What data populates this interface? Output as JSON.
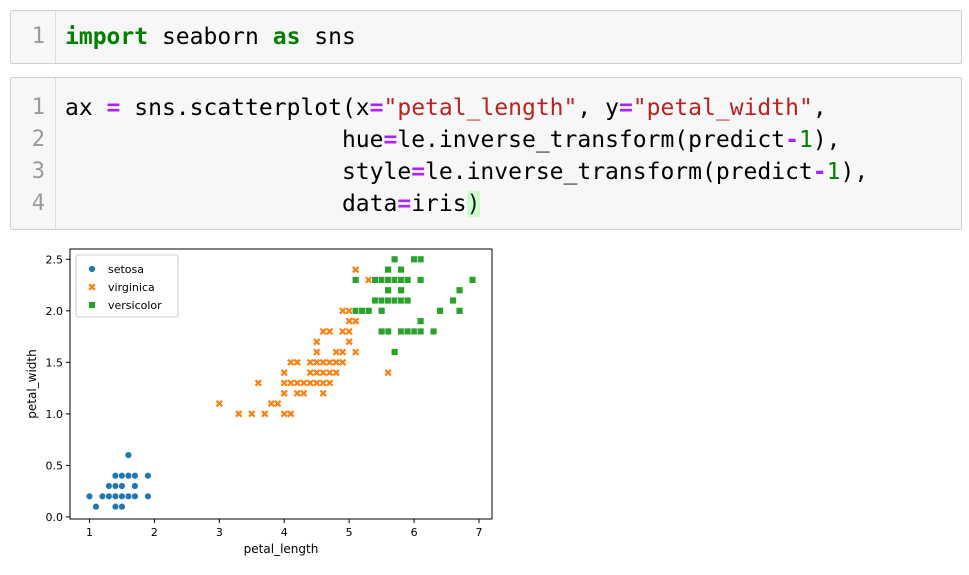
{
  "cell1": {
    "line_numbers": [
      "1"
    ],
    "code": "import seaborn as sns",
    "tokens": [
      {
        "t": "import",
        "c": "kw"
      },
      {
        "t": " seaborn ",
        "c": ""
      },
      {
        "t": "as",
        "c": "kw"
      },
      {
        "t": " sns",
        "c": ""
      }
    ]
  },
  "cell2": {
    "line_numbers": [
      "1",
      "2",
      "3",
      "4"
    ],
    "lines": [
      [
        {
          "t": "ax ",
          "c": ""
        },
        {
          "t": "=",
          "c": "op"
        },
        {
          "t": " sns.scatterplot(x",
          "c": ""
        },
        {
          "t": "=",
          "c": "op"
        },
        {
          "t": "\"petal_length\"",
          "c": "str"
        },
        {
          "t": ", y",
          "c": ""
        },
        {
          "t": "=",
          "c": "op"
        },
        {
          "t": "\"petal_width\"",
          "c": "str"
        },
        {
          "t": ",",
          "c": ""
        }
      ],
      [
        {
          "t": "                    hue",
          "c": ""
        },
        {
          "t": "=",
          "c": "op"
        },
        {
          "t": "le.inverse_transform(predict",
          "c": ""
        },
        {
          "t": "-",
          "c": "op"
        },
        {
          "t": "1",
          "c": "num"
        },
        {
          "t": "),",
          "c": ""
        }
      ],
      [
        {
          "t": "                    style",
          "c": ""
        },
        {
          "t": "=",
          "c": "op"
        },
        {
          "t": "le.inverse_transform(predict",
          "c": ""
        },
        {
          "t": "-",
          "c": "op"
        },
        {
          "t": "1",
          "c": "num"
        },
        {
          "t": "),",
          "c": ""
        }
      ],
      [
        {
          "t": "                    data",
          "c": ""
        },
        {
          "t": "=",
          "c": "op"
        },
        {
          "t": "iris",
          "c": ""
        },
        {
          "t": ")",
          "c": "cur"
        }
      ]
    ]
  },
  "chart_data": {
    "type": "scatter",
    "xlabel": "petal_length",
    "ylabel": "petal_width",
    "xlim": [
      0.7,
      7.2
    ],
    "ylim": [
      -0.02,
      2.6
    ],
    "xticks": [
      1,
      2,
      3,
      4,
      5,
      6,
      7
    ],
    "yticks": [
      0.0,
      0.5,
      1.0,
      1.5,
      2.0,
      2.5
    ],
    "ytick_labels": [
      "0.0",
      "0.5",
      "1.0",
      "1.5",
      "2.0",
      "2.5"
    ],
    "legend_position": "top-left",
    "series": [
      {
        "name": "setosa",
        "marker": "circle",
        "color": "#1f77b4",
        "x": [
          1.0,
          1.1,
          1.2,
          1.3,
          1.4,
          1.5,
          1.6,
          1.7,
          1.9,
          1.9,
          1.3,
          1.4,
          1.5,
          1.6,
          1.7,
          1.4,
          1.5,
          1.6,
          1.4,
          1.5,
          1.3,
          1.5,
          1.6,
          1.7,
          1.9,
          1.6,
          1.7,
          1.6,
          1.4,
          1.5
        ],
        "y": [
          0.2,
          0.1,
          0.2,
          0.2,
          0.2,
          0.2,
          0.2,
          0.2,
          0.2,
          0.4,
          0.3,
          0.3,
          0.3,
          0.4,
          0.4,
          0.4,
          0.4,
          0.6,
          0.1,
          0.1,
          0.2,
          0.2,
          0.2,
          0.2,
          0.2,
          0.2,
          0.3,
          0.4,
          0.2,
          0.2
        ]
      },
      {
        "name": "virginica",
        "marker": "x",
        "color": "#ff7f0e",
        "x": [
          3.0,
          3.3,
          3.5,
          3.7,
          3.9,
          4.0,
          4.0,
          4.1,
          4.2,
          3.8,
          3.6,
          4.0,
          4.1,
          4.2,
          4.3,
          4.4,
          4.5,
          4.6,
          4.7,
          4.0,
          4.4,
          4.5,
          4.6,
          4.7,
          4.8,
          4.1,
          4.2,
          4.4,
          4.5,
          4.6,
          4.7,
          4.8,
          4.9,
          4.3,
          4.5,
          4.8,
          4.9,
          5.0,
          5.1,
          4.5,
          4.9,
          5.0,
          5.1,
          4.6,
          4.7,
          5.0,
          5.2,
          4.9,
          5.1,
          5.0,
          5.1,
          5.3,
          5.6,
          5.1,
          4.6
        ],
        "y": [
          1.1,
          1.0,
          1.0,
          1.0,
          1.1,
          1.0,
          1.2,
          1.0,
          1.2,
          1.1,
          1.3,
          1.3,
          1.3,
          1.3,
          1.3,
          1.3,
          1.3,
          1.3,
          1.3,
          1.4,
          1.4,
          1.4,
          1.4,
          1.4,
          1.4,
          1.5,
          1.5,
          1.5,
          1.5,
          1.5,
          1.5,
          1.5,
          1.5,
          1.2,
          1.6,
          1.6,
          1.6,
          1.7,
          1.6,
          1.7,
          1.8,
          1.8,
          1.9,
          1.8,
          1.8,
          2.0,
          2.0,
          2.0,
          2.0,
          1.9,
          2.4,
          2.3,
          1.4,
          2.3,
          1.2
        ]
      },
      {
        "name": "versicolor",
        "marker": "square",
        "color": "#2ca02c",
        "x": [
          5.1,
          5.2,
          5.3,
          5.4,
          5.5,
          5.6,
          5.7,
          5.8,
          5.9,
          5.1,
          5.5,
          5.6,
          5.7,
          5.8,
          5.6,
          5.8,
          5.6,
          6.1,
          5.7,
          6.0,
          5.9,
          5.5,
          5.8,
          6.1,
          6.3,
          6.6,
          6.7,
          6.9,
          6.7,
          6.4,
          6.6,
          6.0,
          6.1,
          5.6,
          5.8,
          5.9,
          5.7,
          5.4,
          5.5,
          6.1
        ],
        "y": [
          2.0,
          2.0,
          2.0,
          2.1,
          2.1,
          2.1,
          2.1,
          2.1,
          2.1,
          2.3,
          2.3,
          2.3,
          2.3,
          2.3,
          2.4,
          2.4,
          2.2,
          2.5,
          2.5,
          2.5,
          2.3,
          2.0,
          2.2,
          2.3,
          1.8,
          2.1,
          2.2,
          2.3,
          2.0,
          2.0,
          2.1,
          1.8,
          1.9,
          1.8,
          1.8,
          1.8,
          1.6,
          2.3,
          1.8,
          1.8
        ]
      }
    ]
  }
}
